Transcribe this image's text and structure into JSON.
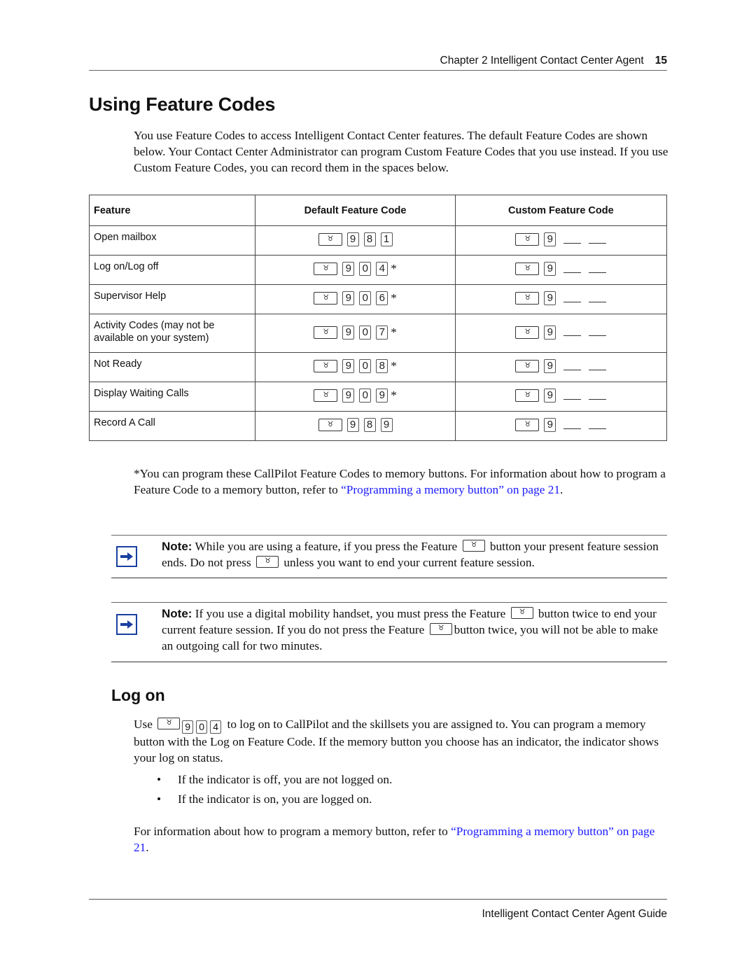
{
  "header": {
    "chapter": "Chapter 2  Intelligent Contact Center Agent",
    "page_number": "15"
  },
  "section": {
    "title": "Using Feature Codes",
    "intro": "You use Feature Codes to access Intelligent Contact Center features. The default Feature Codes are shown below. Your Contact Center Administrator can program Custom Feature Codes that you use instead. If you use Custom Feature Codes, you can record them in the spaces below."
  },
  "table": {
    "headers": [
      "Feature",
      "Default Feature Code",
      "Custom Feature Code"
    ],
    "feature_key_icon": "feature-key-icon",
    "rows": [
      {
        "feature": "Open mailbox",
        "default_digits": [
          "9",
          "8",
          "1"
        ],
        "asterisk": "",
        "custom_digits": [
          "9"
        ]
      },
      {
        "feature": "Log on/Log off",
        "default_digits": [
          "9",
          "0",
          "4"
        ],
        "asterisk": "*",
        "custom_digits": [
          "9"
        ]
      },
      {
        "feature": "Supervisor Help",
        "default_digits": [
          "9",
          "0",
          "6"
        ],
        "asterisk": "*",
        "custom_digits": [
          "9"
        ]
      },
      {
        "feature": "Activity Codes (may not be available on your system)",
        "default_digits": [
          "9",
          "0",
          "7"
        ],
        "asterisk": "*",
        "custom_digits": [
          "9"
        ]
      },
      {
        "feature": "Not Ready",
        "default_digits": [
          "9",
          "0",
          "8"
        ],
        "asterisk": "*",
        "custom_digits": [
          "9"
        ]
      },
      {
        "feature": "Display Waiting Calls",
        "default_digits": [
          "9",
          "0",
          "9"
        ],
        "asterisk": "*",
        "custom_digits": [
          "9"
        ]
      },
      {
        "feature": "Record A Call",
        "default_digits": [
          "9",
          "8",
          "9"
        ],
        "asterisk": "",
        "custom_digits": [
          "9"
        ]
      }
    ]
  },
  "footnote": {
    "text": "*You can program these CallPilot Feature Codes to memory buttons. For information about how to program a Feature Code to a memory button, refer to ",
    "link": "“Programming a memory button” on page 21",
    "end": "."
  },
  "notes": [
    {
      "label": "Note:",
      "icon": "arrow-right-icon",
      "parts": [
        " While you are using a feature, if you press the Feature ",
        " button your present feature session ends. Do not press ",
        " unless you want to end your current feature session."
      ]
    },
    {
      "label": "Note:",
      "icon": "arrow-right-icon",
      "parts": [
        " If you use a digital mobility handset, you must press the Feature ",
        " button twice to end your current feature session. If you do not press the Feature ",
        "button twice, you will not be able to make an outgoing call for two minutes."
      ]
    }
  ],
  "logon": {
    "title": "Log on",
    "use_word": "Use ",
    "digits": [
      "9",
      "0",
      "4"
    ],
    "para_rest": " to log on to CallPilot and the skillsets you are assigned to. You can program a memory button with the Log on Feature Code. If the memory button you choose has an indicator, the indicator shows your log on status.",
    "bullets": [
      "If the indicator is off, you are not logged on.",
      "If the indicator is on, you are logged on."
    ],
    "bullet_char": "•",
    "more_text": "For information about how to program a memory button, refer to ",
    "more_link": "“Programming a memory button” on page 21",
    "more_end": "."
  },
  "footer": {
    "title": "Intelligent Contact Center Agent Guide"
  },
  "colors": {
    "link": "#1a1aff",
    "note_icon": "#1a3fa0"
  },
  "glyphs": {
    "feature_key": "♉"
  }
}
